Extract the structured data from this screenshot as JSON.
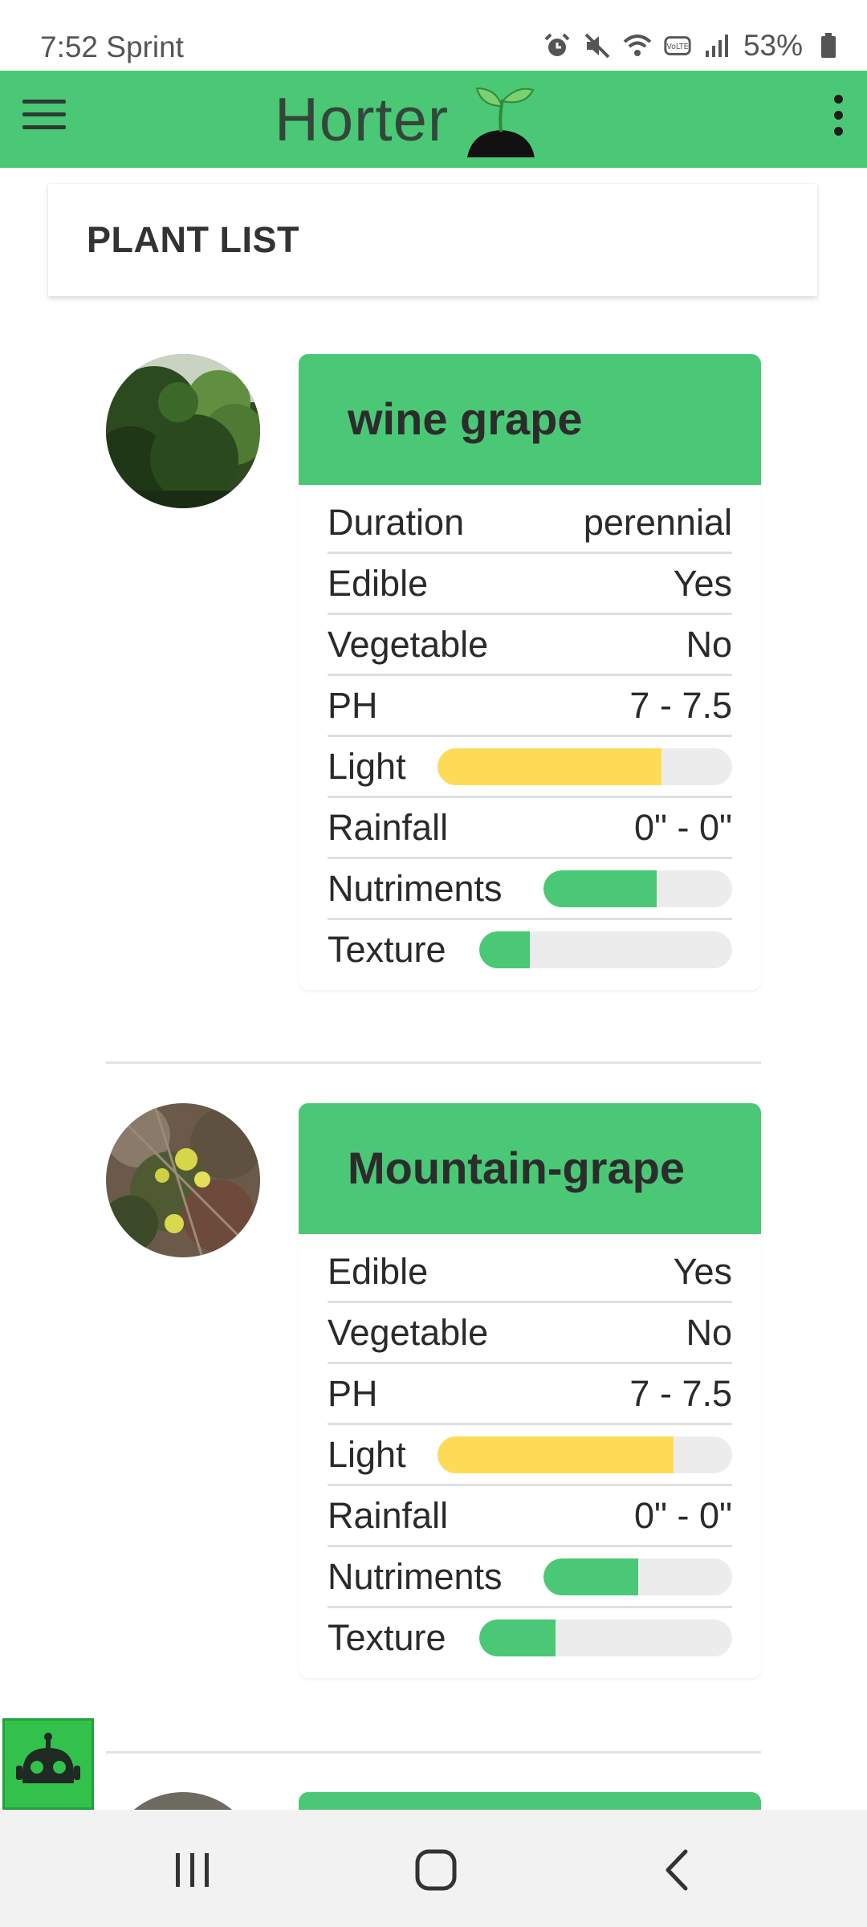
{
  "status_bar": {
    "time_carrier": "7:52 Sprint",
    "battery": "53%",
    "icons": [
      "alarm-icon",
      "mute-icon",
      "wifi-icon",
      "volte-icon",
      "signal-icon",
      "battery-icon"
    ]
  },
  "app_bar": {
    "title": "Horter",
    "menu_icon": "hamburger-menu-icon",
    "overflow_icon": "more-vert-icon",
    "color": "#4bc876"
  },
  "section": {
    "title": "PLANT LIST"
  },
  "plants": [
    {
      "name": "wine grape",
      "rows": [
        {
          "label": "Duration",
          "value": "perennial"
        },
        {
          "label": "Edible",
          "value": "Yes"
        },
        {
          "label": "Vegetable",
          "value": "No"
        },
        {
          "label": "PH",
          "value": "7 - 7.5"
        },
        {
          "label": "Light",
          "level": 0.76,
          "color": "#fedb57"
        },
        {
          "label": "Rainfall",
          "value": "0\" - 0\""
        },
        {
          "label": "Nutriments",
          "level": 0.6,
          "color": "#4bc876"
        },
        {
          "label": "Texture",
          "level": 0.2,
          "color": "#4bc876"
        }
      ]
    },
    {
      "name": "Mountain-grape",
      "rows": [
        {
          "label": "Edible",
          "value": "Yes"
        },
        {
          "label": "Vegetable",
          "value": "No"
        },
        {
          "label": "PH",
          "value": "7 - 7.5"
        },
        {
          "label": "Light",
          "level": 0.8,
          "color": "#fedb57"
        },
        {
          "label": "Rainfall",
          "value": "0\" - 0\""
        },
        {
          "label": "Nutriments",
          "level": 0.5,
          "color": "#4bc876"
        },
        {
          "label": "Texture",
          "level": 0.3,
          "color": "#4bc876"
        }
      ]
    }
  ],
  "fab": {
    "icon": "robot-icon",
    "color": "#32c24b"
  },
  "nav_bar": {
    "icons": [
      "recent-apps-icon",
      "home-icon",
      "back-icon"
    ]
  }
}
